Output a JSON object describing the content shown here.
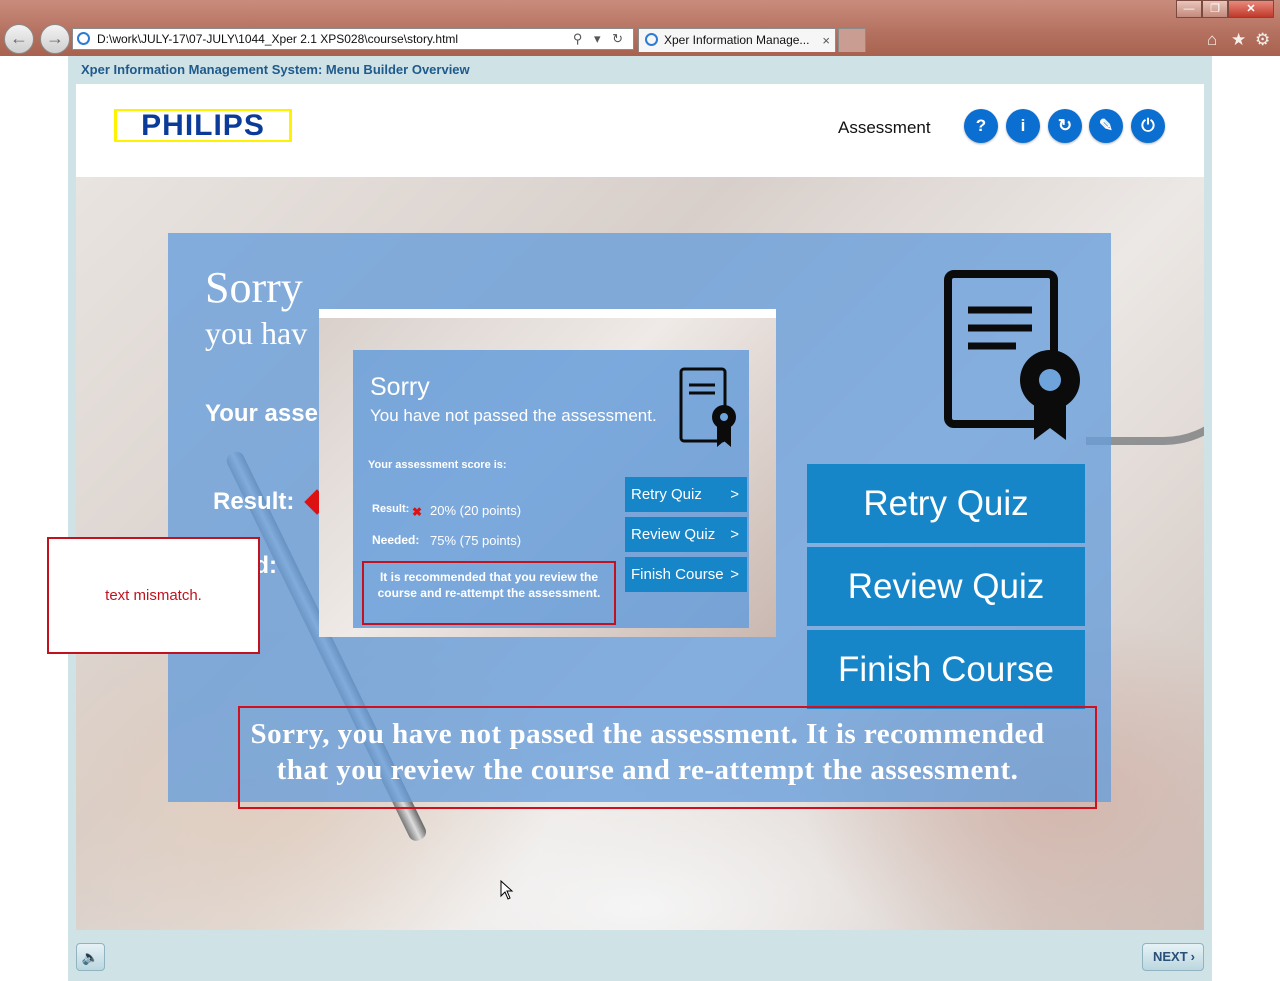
{
  "browser": {
    "address_url": "D:\\work\\JULY-17\\07-JULY\\1044_Xper 2.1 XPS028\\course\\story.html",
    "tab_title": "Xper Information Manage...",
    "tab_close": "×",
    "back": "←",
    "forward": "→",
    "address_tools": "⚲ ▾ ↻",
    "home": "⌂",
    "favorites": "★",
    "settings": "⚙",
    "minimize": "—",
    "restore": "❐",
    "close": "✕"
  },
  "course": {
    "title": "Xper Information Management System: Menu Builder Overview",
    "logo": "PHILIPS",
    "section_label": "Assessment",
    "header_buttons": [
      {
        "icon": "help-icon",
        "glyph": "?"
      },
      {
        "icon": "info-icon",
        "glyph": "i"
      },
      {
        "icon": "replay-icon",
        "glyph": "↻"
      },
      {
        "icon": "edit-icon",
        "glyph": "✎"
      },
      {
        "icon": "power-icon",
        "glyph": "⏻"
      }
    ]
  },
  "result_panel": {
    "sorry": "Sorry",
    "subtitle": "you hav",
    "score_label": "Your asse",
    "result_label": "Result:",
    "needed_label": "eded:",
    "buttons": [
      "Retry Quiz",
      "Review Quiz",
      "Finish Course"
    ]
  },
  "reference": {
    "sorry": "Sorry",
    "subtitle": "You have not passed the assessment.",
    "score_label": "Your assessment score is:",
    "result_label": "Result:",
    "result_value": "20% (20 points)",
    "needed_label": "Needed:",
    "needed_value": "75% (75 points)",
    "recommendation": "It is recommended that you review the course and re-attempt the assessment.",
    "buttons": [
      "Retry Quiz",
      "Review Quiz",
      "Finish Course"
    ],
    "chevron": ">"
  },
  "annotation": {
    "note": "text mismatch.",
    "caption": "Sorry, you have not passed the assessment. It is recommended that you review the course and re-attempt the assessment."
  },
  "footer": {
    "next_label": "NEXT",
    "next_chevron": "›",
    "audio_glyph": "🔈"
  },
  "colors": {
    "panel_blue": "#679edb",
    "button_blue": "#1686c9",
    "header_icon_blue": "#0b6fd1",
    "annotation_red": "#c1121f"
  }
}
